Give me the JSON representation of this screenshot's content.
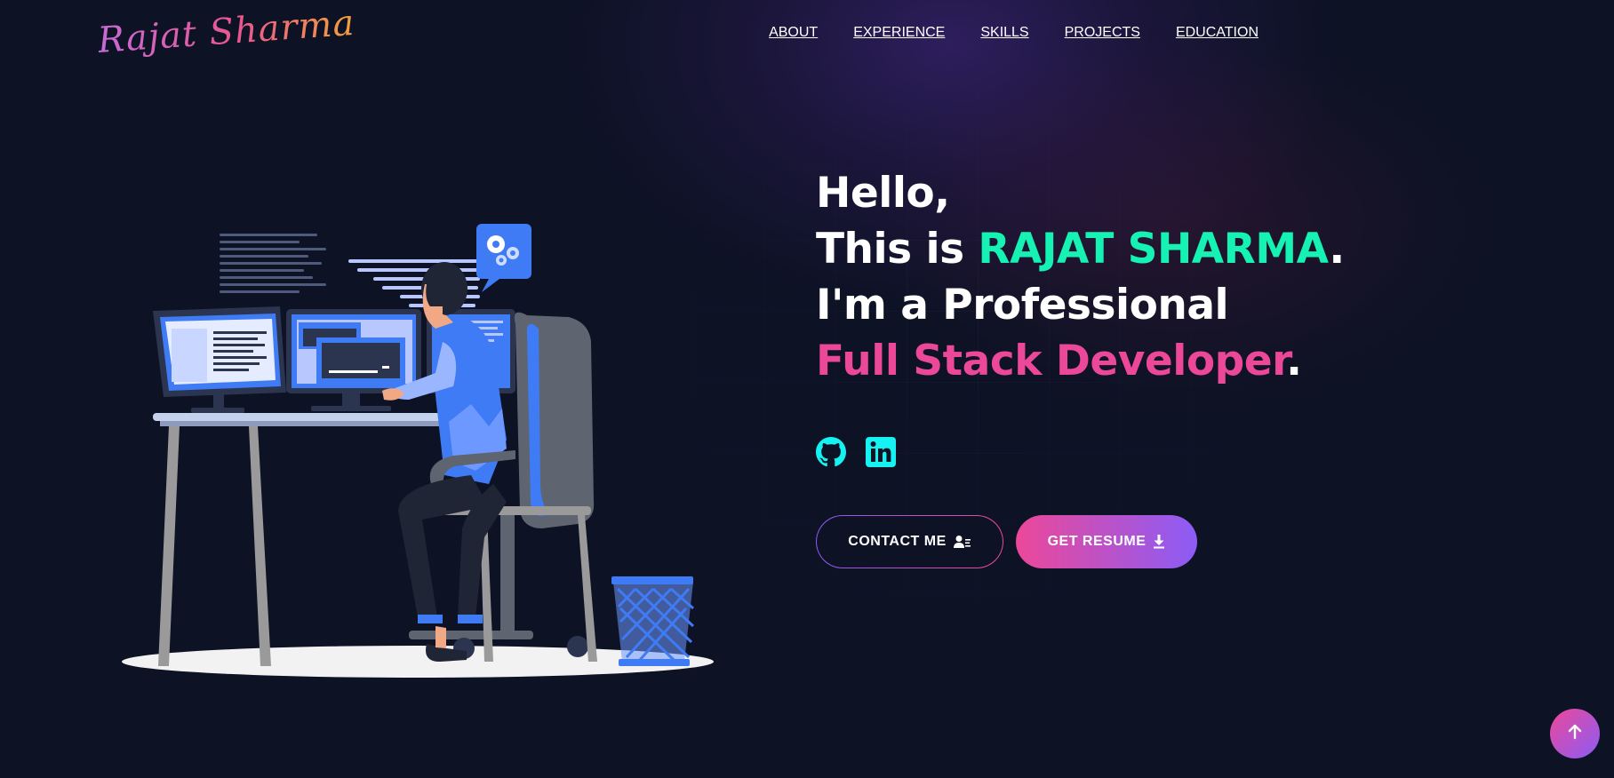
{
  "brand": {
    "logo_text": "Rajat Sharma",
    "colors": {
      "bg": "#0d1224",
      "green": "#16f2b3",
      "pink": "#ec4899",
      "violet": "#8b5cf6",
      "social": "#16f2f2"
    }
  },
  "nav": {
    "items": [
      {
        "label": "ABOUT"
      },
      {
        "label": "EXPERIENCE"
      },
      {
        "label": "SKILLS"
      },
      {
        "label": "PROJECTS"
      },
      {
        "label": "EDUCATION"
      }
    ]
  },
  "hero": {
    "line1": "Hello,",
    "line2_prefix": "This is ",
    "name": "RAJAT SHARMA",
    "line2_suffix": ".",
    "line3": "I'm a Professional",
    "role": "Full Stack Developer",
    "line4_suffix": "."
  },
  "socials": [
    {
      "icon": "github-icon"
    },
    {
      "icon": "linkedin-icon"
    }
  ],
  "buttons": {
    "contact_label": "CONTACT ME",
    "contact_icon": "contact-card-icon",
    "resume_label": "GET RESUME",
    "resume_icon": "download-icon"
  },
  "scroll_top": {
    "icon": "arrow-up-icon"
  },
  "illustration": {
    "name": "developer-at-desk-illustration"
  }
}
